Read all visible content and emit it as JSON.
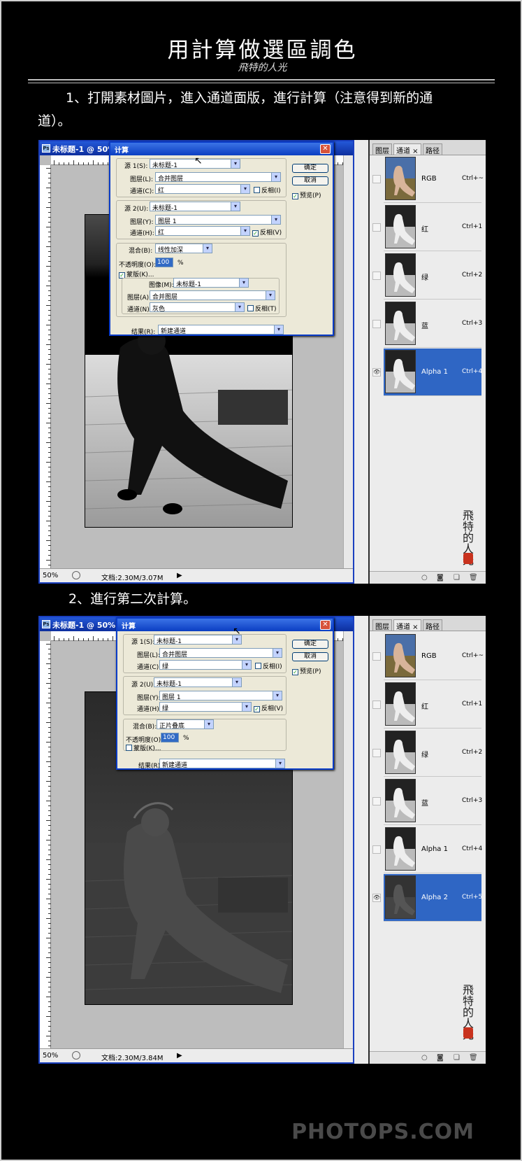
{
  "header": {
    "title": "用計算做選區調色",
    "subtitle": "飛特的人光"
  },
  "step1": {
    "text": "1、打開素材圖片，進入通道面版，進行計算（注意得到新的通道）。"
  },
  "step2": {
    "text": "2、進行第二次計算。"
  },
  "shot1": {
    "window_title": "未标题-1 @ 50%",
    "status_zoom": "50%",
    "status_doc": "文档:2.30M/3.07M",
    "dialog": {
      "title": "计算",
      "source1": {
        "label": "源 1(S):",
        "value": "未标题-1",
        "layer_label": "图层(L):",
        "layer_value": "合并图层",
        "channel_label": "通道(C):",
        "channel_value": "红",
        "invert_label": "反相(I)",
        "invert_checked": false
      },
      "source2": {
        "label": "源 2(U):",
        "value": "未标题-1",
        "layer_label": "图层(Y):",
        "layer_value": "图层 1",
        "channel_label": "通道(H):",
        "channel_value": "红",
        "invert_label": "反相(V)",
        "invert_checked": true
      },
      "blend_label": "混合(B):",
      "blend_value": "线性加深",
      "opacity_label": "不透明度(O):",
      "opacity_value": "100",
      "opacity_unit": "%",
      "mask_label": "蒙版(K)...",
      "mask_checked": true,
      "mask": {
        "image_label": "图像(M):",
        "image_value": "未标题-1",
        "layer_label": "图层(A):",
        "layer_value": "合并图层",
        "channel_label": "通道(N):",
        "channel_value": "灰色",
        "invert_label": "反相(T)",
        "invert_checked": false
      },
      "result_label": "结果(R):",
      "result_value": "新建通道",
      "ok_label": "确定",
      "cancel_label": "取消",
      "preview_label": "预览(P)",
      "preview_checked": true
    },
    "panel": {
      "tabs": [
        "图层",
        "通道 ×",
        "路径"
      ],
      "channels": [
        {
          "name": "RGB",
          "key": "Ctrl+~"
        },
        {
          "name": "红",
          "key": "Ctrl+1"
        },
        {
          "name": "绿",
          "key": "Ctrl+2"
        },
        {
          "name": "蓝",
          "key": "Ctrl+3"
        },
        {
          "name": "Alpha 1",
          "key": "Ctrl+4",
          "selected": true
        }
      ]
    }
  },
  "shot2": {
    "window_title": "未标题-1 @ 50%",
    "status_zoom": "50%",
    "status_doc": "文档:2.30M/3.84M",
    "dialog": {
      "title": "计算",
      "source1": {
        "label": "源 1(S):",
        "value": "未标题-1",
        "layer_label": "图层(L):",
        "layer_value": "合并图层",
        "channel_label": "通道(C):",
        "channel_value": "绿",
        "invert_label": "反相(I)",
        "invert_checked": false
      },
      "source2": {
        "label": "源 2(U):",
        "value": "未标题-1",
        "layer_label": "图层(Y):",
        "layer_value": "图层 1",
        "channel_label": "通道(H):",
        "channel_value": "绿",
        "invert_label": "反相(V)",
        "invert_checked": true
      },
      "blend_label": "混合(B):",
      "blend_value": "正片叠底",
      "opacity_label": "不透明度(O):",
      "opacity_value": "100",
      "opacity_unit": "%",
      "mask_label": "蒙版(K)...",
      "mask_checked": false,
      "result_label": "结果(R):",
      "result_value": "新建通道",
      "ok_label": "确定",
      "cancel_label": "取消",
      "preview_label": "预览(P)",
      "preview_checked": true
    },
    "panel": {
      "tabs": [
        "图层",
        "通道 ×",
        "路径"
      ],
      "channels": [
        {
          "name": "RGB",
          "key": "Ctrl+~"
        },
        {
          "name": "红",
          "key": "Ctrl+1"
        },
        {
          "name": "绿",
          "key": "Ctrl+2"
        },
        {
          "name": "蓝",
          "key": "Ctrl+3"
        },
        {
          "name": "Alpha 1",
          "key": "Ctrl+4"
        },
        {
          "name": "Alpha 2",
          "key": "Ctrl+5",
          "selected": true
        }
      ]
    }
  },
  "watermark": "PHOTOPS.COM",
  "colors": {
    "dialog_border": "#0a3cc8",
    "selection": "#2f66c4",
    "window_frame": "#1a3fbf"
  }
}
